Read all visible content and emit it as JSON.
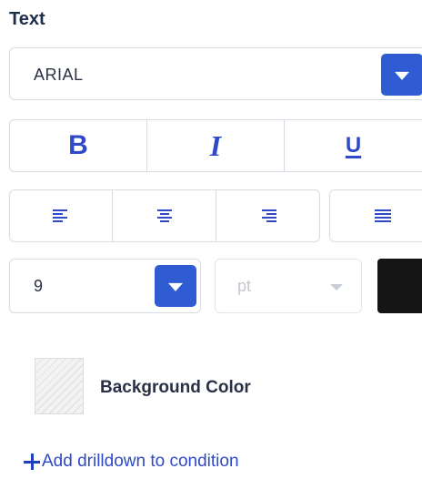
{
  "text_section": {
    "title": "Text"
  },
  "font_family": {
    "value": "ARIAL"
  },
  "style_buttons": {
    "bold": "B",
    "italic": "I",
    "underline": "U"
  },
  "alignment_buttons": [
    {
      "name": "align-left-icon"
    },
    {
      "name": "align-center-icon"
    },
    {
      "name": "align-right-icon"
    },
    {
      "name": "align-justify-icon"
    }
  ],
  "font_size": {
    "value": "9"
  },
  "unit": {
    "value": "pt"
  },
  "font_color": {
    "value": "#151515"
  },
  "background": {
    "label": "Background Color"
  },
  "drilldown": {
    "label": "Add drilldown to condition"
  },
  "colors": {
    "accent": "#2f5bd3",
    "icon_blue": "#2f49c8",
    "text_dark": "#2a3147",
    "border": "#d7dbe3"
  }
}
